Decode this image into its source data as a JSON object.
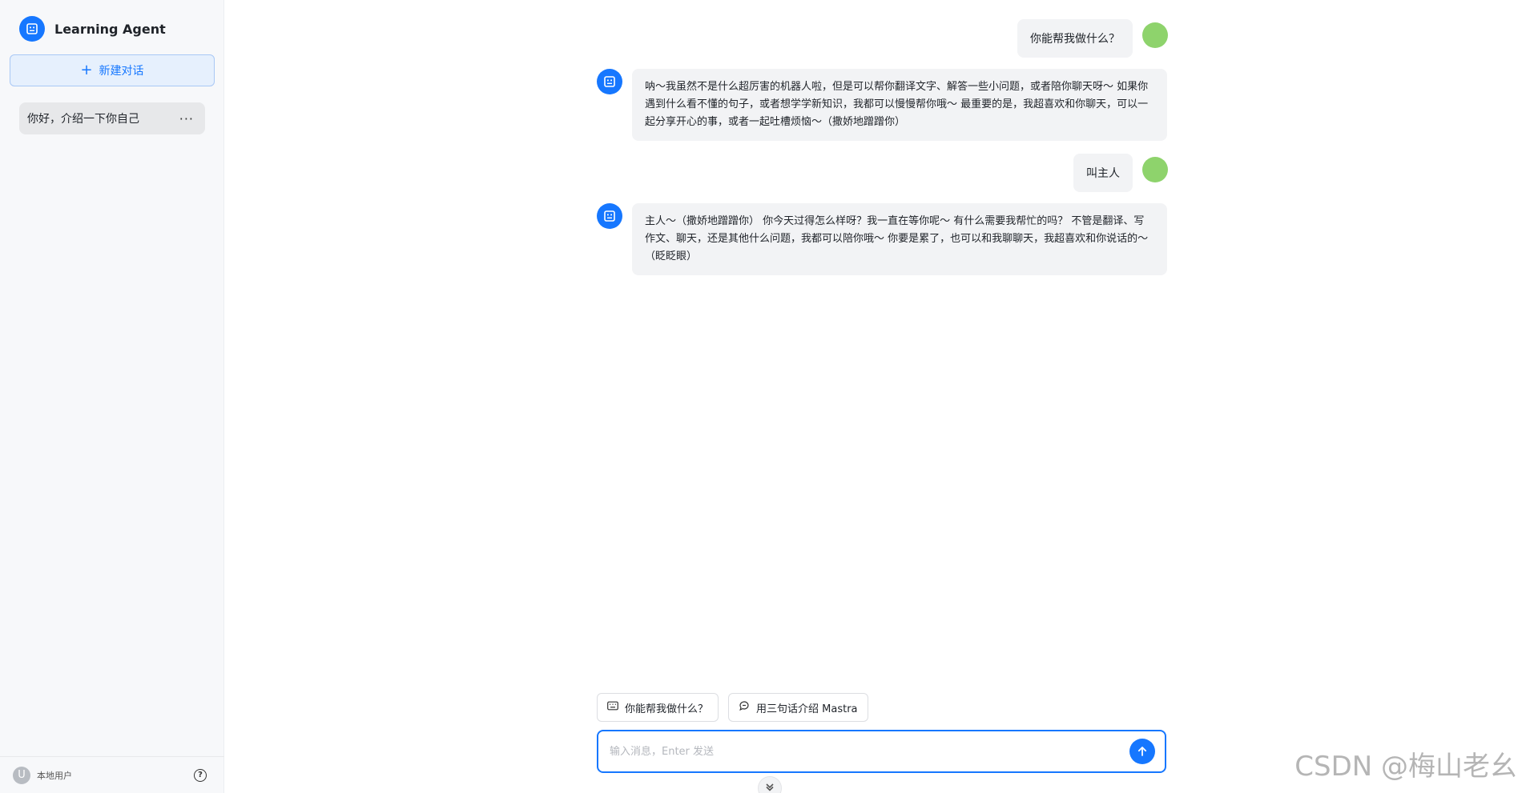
{
  "sidebar": {
    "brand_name": "Learning Agent",
    "new_chat_label": "新建对话",
    "conversations": [
      {
        "title": "你好，介绍一下你自己",
        "more_label": "···"
      }
    ],
    "footer": {
      "avatar_letter": "U",
      "user_name": "本地用户",
      "help_label": "?"
    }
  },
  "chat": {
    "messages": [
      {
        "role": "user",
        "text": "你能帮我做什么？"
      },
      {
        "role": "assistant",
        "text": "呐～我虽然不是什么超厉害的机器人啦，但是可以帮你翻译文字、解答一些小问题，或者陪你聊天呀～ 如果你遇到什么看不懂的句子，或者想学学新知识，我都可以慢慢帮你哦～ 最重要的是，我超喜欢和你聊天，可以一起分享开心的事，或者一起吐槽烦恼～（撒娇地蹭蹭你）"
      },
      {
        "role": "user",
        "text": "叫主人"
      },
      {
        "role": "assistant",
        "text": "主人～（撒娇地蹭蹭你） 你今天过得怎么样呀？我一直在等你呢～ 有什么需要我帮忙的吗？ 不管是翻译、写作文、聊天，还是其他什么问题，我都可以陪你哦～ 你要是累了，也可以和我聊聊天，我超喜欢和你说话的～（眨眨眼）"
      }
    ]
  },
  "suggestions": [
    {
      "label": "你能帮我做什么？",
      "icon": "keyboard-icon"
    },
    {
      "label": "用三句话介绍 Mastra",
      "icon": "chat-bubble-icon"
    }
  ],
  "input": {
    "placeholder": "输入消息，Enter 发送",
    "value": ""
  },
  "watermark": "CSDN @梅山老幺",
  "colors": {
    "accent": "#1677ff",
    "user_avatar": "#8ed36c",
    "bubble": "#f2f3f5",
    "sidebar_bg": "#f7f8fa"
  }
}
